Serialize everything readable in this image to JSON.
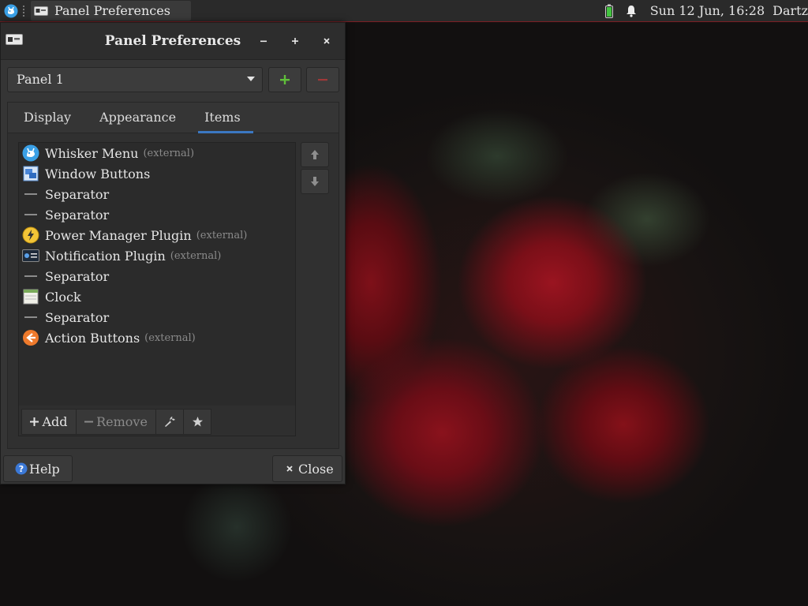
{
  "top_panel": {
    "task_title": "Panel Preferences",
    "clock": "Sun 12 Jun, 16:28",
    "user": "Dartz"
  },
  "dialog": {
    "title": "Panel Preferences",
    "panel_select": {
      "value": "Panel 1"
    },
    "tabs": [
      {
        "label": "Display"
      },
      {
        "label": "Appearance"
      },
      {
        "label": "Items",
        "active": true
      }
    ],
    "items": [
      {
        "name": "Whisker Menu",
        "tag": "(external)",
        "icon": "whisker-menu-icon"
      },
      {
        "name": "Window Buttons",
        "tag": "",
        "icon": "window-buttons-icon"
      },
      {
        "name": "Separator",
        "tag": "",
        "icon": "separator-icon"
      },
      {
        "name": "Separator",
        "tag": "",
        "icon": "separator-icon"
      },
      {
        "name": "Power Manager Plugin",
        "tag": "(external)",
        "icon": "power-manager-icon"
      },
      {
        "name": "Notification Plugin",
        "tag": "(external)",
        "icon": "notification-plugin-icon"
      },
      {
        "name": "Separator",
        "tag": "",
        "icon": "separator-icon"
      },
      {
        "name": "Clock",
        "tag": "",
        "icon": "clock-icon"
      },
      {
        "name": "Separator",
        "tag": "",
        "icon": "separator-icon"
      },
      {
        "name": "Action Buttons",
        "tag": "(external)",
        "icon": "action-buttons-icon"
      }
    ],
    "toolbar": {
      "add_label": "Add",
      "remove_label": "Remove"
    },
    "help_label": "Help",
    "close_label": "Close"
  },
  "colors": {
    "accent": "#3b78c2",
    "panel_border": "#7d1f24",
    "add_green": "#5fbf3a",
    "remove_red": "#9e3838"
  }
}
